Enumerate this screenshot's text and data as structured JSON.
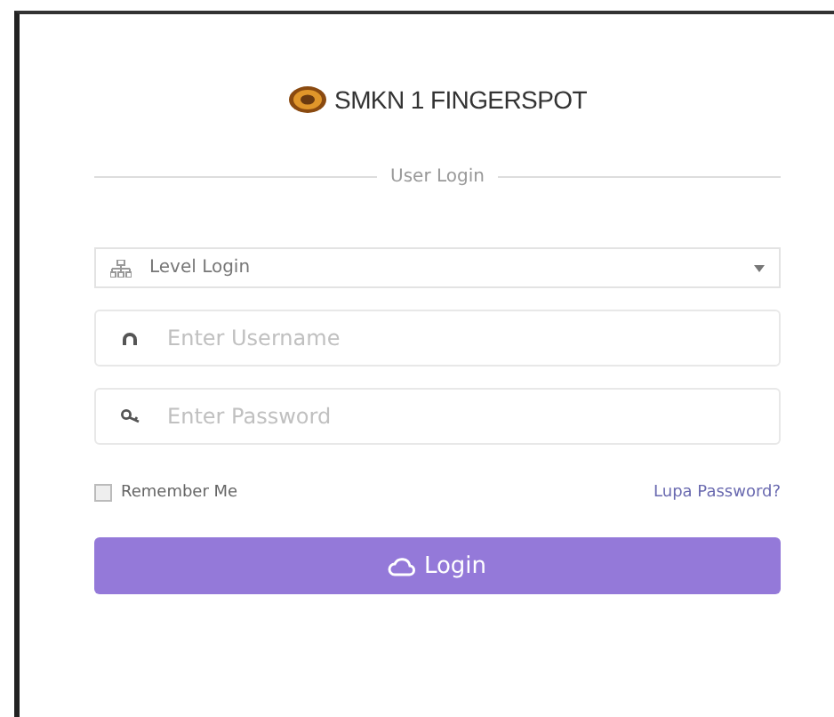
{
  "brand": {
    "name": "SMKN 1 FINGERSPOT"
  },
  "heading": "User Login",
  "level_select": {
    "value": "Level Login"
  },
  "fields": [
    {
      "kind": "user",
      "placeholder": "Enter Username"
    },
    {
      "kind": "key",
      "placeholder": "Enter Password"
    }
  ],
  "remember": {
    "label": "Remember Me",
    "checked": false
  },
  "forgot_link": "Lupa Password?",
  "login_button": "Login"
}
